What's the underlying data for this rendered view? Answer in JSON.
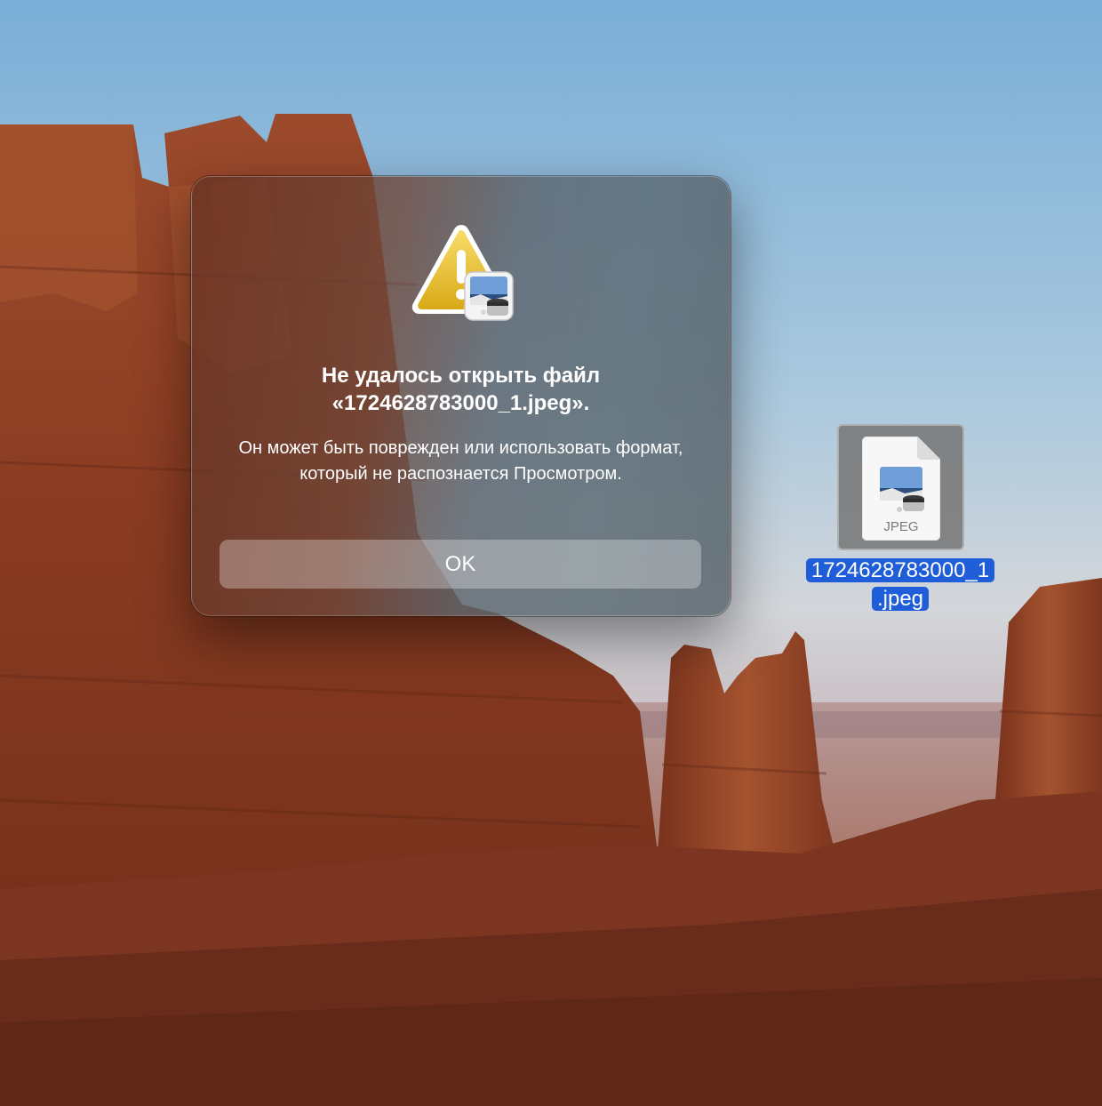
{
  "desktop": {
    "wallpaper": "canyon-rock-formations-wallpaper"
  },
  "alert": {
    "title": "Не удалось открыть файл «1724628783000_1.jpeg».",
    "message": "Он может быть поврежден или использовать формат, который не распознается Просмотром.",
    "ok_label": "OK",
    "icon": "warning-triangle-with-preview-app-icon"
  },
  "file": {
    "name": "1724628783000_1.jpeg",
    "type_label": "JPEG",
    "icon": "jpeg-document-icon",
    "selection_color": "#1f5ed8"
  },
  "colors": {
    "warning_yellow": "#f2c94c",
    "selection_blue": "#1f5ed8"
  }
}
